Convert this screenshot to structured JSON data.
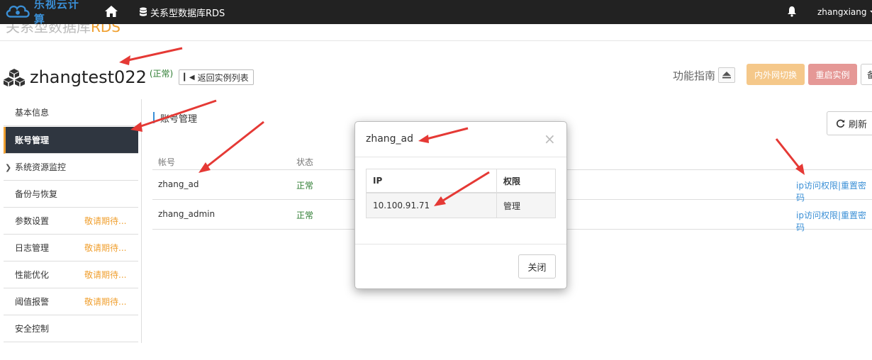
{
  "topbar": {
    "logo_text": "乐视云计算",
    "nav_rds": "关系型数据库RDS",
    "username": "zhangxiang"
  },
  "breadcrumb": {
    "title_main": "关系型数据库",
    "title_accent": "RDS"
  },
  "instance": {
    "name": "zhangtest022",
    "status": "(正常)",
    "back_label": "返回实例列表"
  },
  "actions": {
    "guide_label": "功能指南",
    "switch_label": "内外网切换",
    "restart_label": "重启实例",
    "more_label": "备"
  },
  "sidebar": {
    "items": [
      {
        "label": "基本信息",
        "soon": ""
      },
      {
        "label": "账号管理",
        "soon": ""
      },
      {
        "label": "系统资源监控",
        "soon": ""
      },
      {
        "label": "备份与恢复",
        "soon": ""
      },
      {
        "label": "参数设置",
        "soon": "敬请期待..."
      },
      {
        "label": "日志管理",
        "soon": "敬请期待..."
      },
      {
        "label": "性能优化",
        "soon": "敬请期待..."
      },
      {
        "label": "阈值报警",
        "soon": "敬请期待..."
      },
      {
        "label": "安全控制",
        "soon": ""
      }
    ]
  },
  "content": {
    "title": "账号管理",
    "refresh_label": "刷新",
    "table": {
      "headers": [
        "帐号",
        "状态"
      ],
      "rows": [
        {
          "account": "zhang_ad",
          "status": "正常",
          "links": "ip访问权限|重置密码"
        },
        {
          "account": "zhang_admin",
          "status": "正常",
          "links": "ip访问权限|重置密码"
        }
      ]
    }
  },
  "modal": {
    "title": "zhang_ad",
    "close_x": "×",
    "headers": [
      "IP",
      "权限"
    ],
    "rows": [
      {
        "ip": "10.100.91.71",
        "perm": "管理"
      }
    ],
    "close_button": "关闭"
  },
  "colors": {
    "topbar": "#222222",
    "accent_orange": "#f0a030",
    "link_blue": "#3a8fd6",
    "status_green": "#2e7d32",
    "annotation_red": "#e53935"
  }
}
